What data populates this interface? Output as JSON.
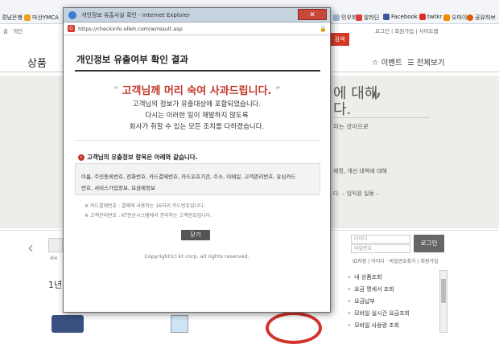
{
  "bookmarks": {
    "left_items": [
      "경남은행",
      "마산YMCA"
    ],
    "right_items": [
      "민우회",
      "알라딘",
      "Facebook",
      "twtkr",
      "오마이",
      "공유허브"
    ]
  },
  "header": {
    "top_links_left": "홈 · 개인",
    "top_links_right": "로그인 | 회원가입 | 사이트맵",
    "red_tab": "검색",
    "nav_first": "상품",
    "nav_event": "이벤트",
    "nav_all": "전체보기",
    "menu_icon": "hamburger-icon",
    "star_icon": "star-icon"
  },
  "banner": {
    "line1": "에 대해",
    "line2": "다.",
    "line3": "리는 것이므로",
    "line4": "제정, 개선 대책에 대해",
    "line5": "다. – 임직원 일동 –",
    "close_quote": "”"
  },
  "popup": {
    "window_title": "개인정보 유출사실 확인 - Internet Explorer",
    "url": "https://checkinfo.olleh.com/w/result.asp",
    "url_icon_letter": "G",
    "close_label": "✕",
    "page_title": "개인정보 유출여부 확인 결과",
    "apology": "고객님께 머리 숙여 사과드립니다.",
    "open_quote": "“",
    "close_quote": "”",
    "message_lines": [
      "고객님의 정보가 유출대상에 포함되었습니다.",
      "다시는 이러한 일이 재발하지 않도록",
      "회사가 취할 수 있는 모든 조치를 다하겠습니다."
    ],
    "section_title": "고객님의 유출정보 항목은 아래와 같습니다.",
    "item_lines": [
      "이름, 주민등록번호, 전화번호, 카드결제번호, 카드유효기간, 주소, 이메일, 고객관리번호, 유심카드",
      "번호, 서비스가입정보, 요금제정보"
    ],
    "notes": [
      "※ 카드결제번호 : 결제에 사용하는 16자리 카드번호입니다.",
      "※ 고객관리번호 : KT전산시스템에서 관리하는 고객번호입니다."
    ],
    "ok_button": "닫기",
    "copyright": "Copyright(c) kt corp. all rights reserved."
  },
  "login": {
    "id_placeholder": "아이디",
    "pw_placeholder": "비밀번호",
    "button": "로그인",
    "links": "ID저장 | 아이디 · 비밀번호찾기 | 회원가입"
  },
  "side_menu": [
    "내 상품조회",
    "요금 명세서 조회",
    "요금납부",
    "모바일 실시간 요금조회",
    "모바일 사용량 조회"
  ],
  "bottom": {
    "year_label": "1년",
    "left_arrow": "‹",
    "thumb_caption": "Ale"
  }
}
